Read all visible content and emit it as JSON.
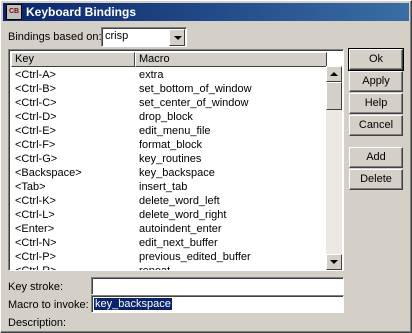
{
  "window": {
    "title": "Keyboard Bindings",
    "icon": "app-icon"
  },
  "bindings_based_on": {
    "label": "Bindings based on:",
    "value": "crisp"
  },
  "list": {
    "columns": [
      "Key",
      "Macro"
    ],
    "rows": [
      [
        "<Ctrl-A>",
        "extra"
      ],
      [
        "<Ctrl-B>",
        "set_bottom_of_window"
      ],
      [
        "<Ctrl-C>",
        "set_center_of_window"
      ],
      [
        "<Ctrl-D>",
        "drop_block"
      ],
      [
        "<Ctrl-E>",
        "edit_menu_file"
      ],
      [
        "<Ctrl-F>",
        "format_block"
      ],
      [
        "<Ctrl-G>",
        "key_routines"
      ],
      [
        "<Backspace>",
        "key_backspace"
      ],
      [
        "<Tab>",
        "insert_tab"
      ],
      [
        "<Ctrl-K>",
        "delete_word_left"
      ],
      [
        "<Ctrl-L>",
        "delete_word_right"
      ],
      [
        "<Enter>",
        "autoindent_enter"
      ],
      [
        "<Ctrl-N>",
        "edit_next_buffer"
      ],
      [
        "<Ctrl-P>",
        "previous_edited_buffer"
      ],
      [
        "<Ctrl-R>",
        "repeat"
      ]
    ]
  },
  "buttons": {
    "ok": "Ok",
    "apply": "Apply",
    "help": "Help",
    "cancel": "Cancel",
    "add": "Add",
    "delete": "Delete"
  },
  "fields": {
    "key_stroke": {
      "label": "Key stroke:",
      "value": ""
    },
    "macro": {
      "label": "Macro to invoke:",
      "value": "key_backspace"
    },
    "description": {
      "label": "Description:"
    }
  }
}
